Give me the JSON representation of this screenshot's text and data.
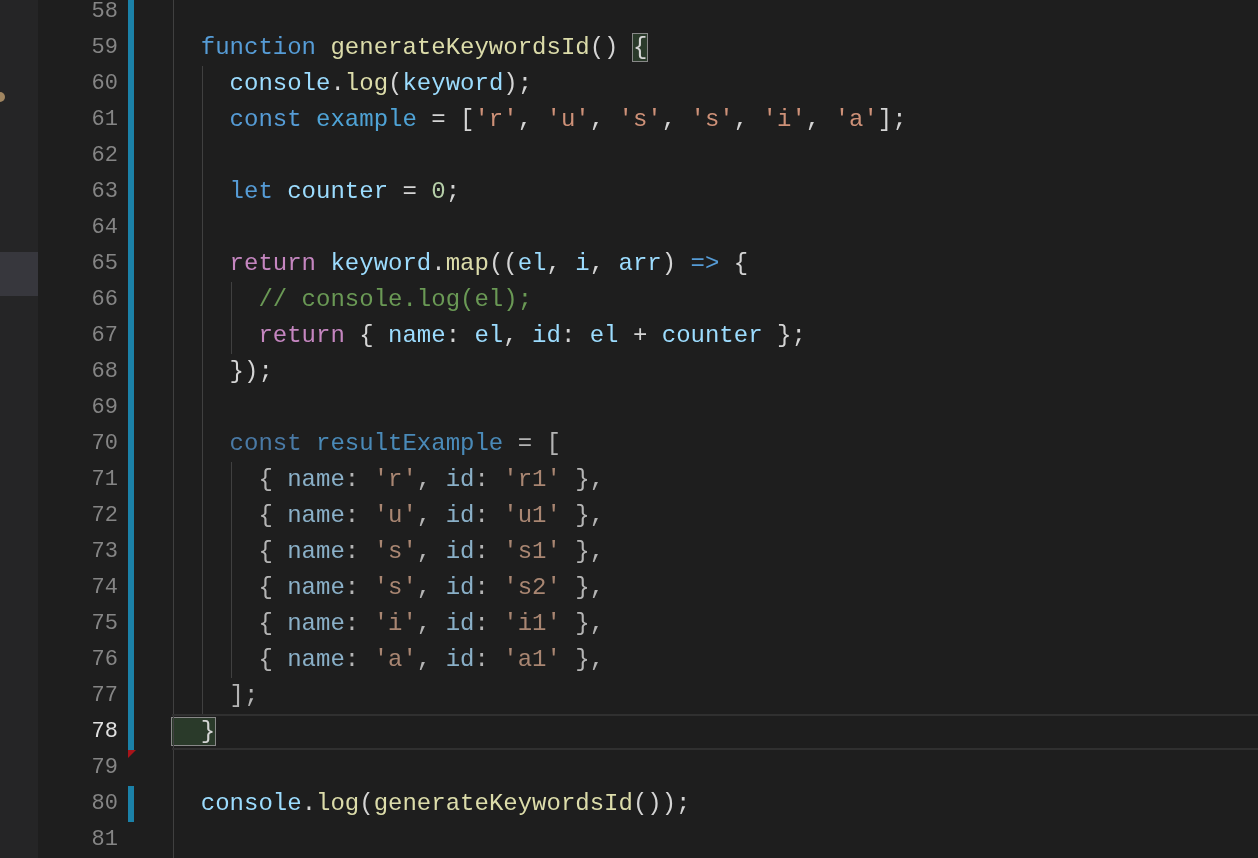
{
  "editor": {
    "lines": [
      {
        "number": "58",
        "current": false,
        "modified": true,
        "deleted": false
      },
      {
        "number": "59",
        "current": false,
        "modified": true,
        "deleted": false,
        "tokens": [
          {
            "text": "  function ",
            "kind": "keyword"
          },
          {
            "text": "generateKeywordsId",
            "kind": "function"
          },
          {
            "text": "() ",
            "kind": "plain"
          },
          {
            "text": "{",
            "kind": "bracket-match"
          }
        ]
      },
      {
        "number": "60",
        "current": false,
        "modified": true,
        "deleted": false,
        "tokens": [
          {
            "text": "    console",
            "kind": "variable"
          },
          {
            "text": ".",
            "kind": "plain"
          },
          {
            "text": "log",
            "kind": "function"
          },
          {
            "text": "(",
            "kind": "plain"
          },
          {
            "text": "keyword",
            "kind": "variable"
          },
          {
            "text": ");",
            "kind": "plain"
          }
        ]
      },
      {
        "number": "61",
        "current": false,
        "modified": true,
        "deleted": false,
        "tokens": [
          {
            "text": "    const ",
            "kind": "keyword"
          },
          {
            "text": "example",
            "kind": "constant"
          },
          {
            "text": " = [",
            "kind": "plain"
          },
          {
            "text": "'r'",
            "kind": "string"
          },
          {
            "text": ", ",
            "kind": "plain"
          },
          {
            "text": "'u'",
            "kind": "string"
          },
          {
            "text": ", ",
            "kind": "plain"
          },
          {
            "text": "'s'",
            "kind": "string"
          },
          {
            "text": ", ",
            "kind": "plain"
          },
          {
            "text": "'s'",
            "kind": "string"
          },
          {
            "text": ", ",
            "kind": "plain"
          },
          {
            "text": "'i'",
            "kind": "string"
          },
          {
            "text": ", ",
            "kind": "plain"
          },
          {
            "text": "'a'",
            "kind": "string"
          },
          {
            "text": "];",
            "kind": "plain"
          }
        ]
      },
      {
        "number": "62",
        "current": false,
        "modified": true,
        "deleted": false
      },
      {
        "number": "63",
        "current": false,
        "modified": true,
        "deleted": false,
        "tokens": [
          {
            "text": "    let ",
            "kind": "keyword"
          },
          {
            "text": "counter",
            "kind": "variable"
          },
          {
            "text": " = ",
            "kind": "plain"
          },
          {
            "text": "0",
            "kind": "number"
          },
          {
            "text": ";",
            "kind": "plain"
          }
        ]
      },
      {
        "number": "64",
        "current": false,
        "modified": true,
        "deleted": false
      },
      {
        "number": "65",
        "current": false,
        "modified": true,
        "deleted": false,
        "tokens": [
          {
            "text": "    return ",
            "kind": "control"
          },
          {
            "text": "keyword",
            "kind": "variable"
          },
          {
            "text": ".",
            "kind": "plain"
          },
          {
            "text": "map",
            "kind": "function"
          },
          {
            "text": "((",
            "kind": "plain"
          },
          {
            "text": "el",
            "kind": "variable"
          },
          {
            "text": ", ",
            "kind": "plain"
          },
          {
            "text": "i",
            "kind": "variable"
          },
          {
            "text": ", ",
            "kind": "plain"
          },
          {
            "text": "arr",
            "kind": "variable"
          },
          {
            "text": ") ",
            "kind": "plain"
          },
          {
            "text": "=>",
            "kind": "keyword"
          },
          {
            "text": " {",
            "kind": "plain"
          }
        ]
      },
      {
        "number": "66",
        "current": false,
        "modified": true,
        "deleted": false,
        "tokens": [
          {
            "text": "      // console.log(el);",
            "kind": "comment"
          }
        ]
      },
      {
        "number": "67",
        "current": false,
        "modified": true,
        "deleted": false,
        "tokens": [
          {
            "text": "      return",
            "kind": "control"
          },
          {
            "text": " { ",
            "kind": "plain"
          },
          {
            "text": "name",
            "kind": "variable"
          },
          {
            "text": ": ",
            "kind": "plain"
          },
          {
            "text": "el",
            "kind": "variable"
          },
          {
            "text": ", ",
            "kind": "plain"
          },
          {
            "text": "id",
            "kind": "variable"
          },
          {
            "text": ": ",
            "kind": "plain"
          },
          {
            "text": "el",
            "kind": "variable"
          },
          {
            "text": " + ",
            "kind": "plain"
          },
          {
            "text": "counter",
            "kind": "variable"
          },
          {
            "text": " };",
            "kind": "plain"
          }
        ]
      },
      {
        "number": "68",
        "current": false,
        "modified": true,
        "deleted": false,
        "tokens": [
          {
            "text": "    });",
            "kind": "plain"
          }
        ]
      },
      {
        "number": "69",
        "current": false,
        "modified": true,
        "deleted": false
      },
      {
        "number": "70",
        "current": false,
        "modified": true,
        "deleted": false,
        "tokens": [
          {
            "text": "    const ",
            "kind": "keyword-dim"
          },
          {
            "text": "resultExample",
            "kind": "constant-dim"
          },
          {
            "text": " = [",
            "kind": "plain-dim"
          }
        ]
      },
      {
        "number": "71",
        "current": false,
        "modified": true,
        "deleted": false,
        "tokens": [
          {
            "text": "      { ",
            "kind": "plain-dim"
          },
          {
            "text": "name",
            "kind": "variable-dim"
          },
          {
            "text": ": ",
            "kind": "plain-dim"
          },
          {
            "text": "'r'",
            "kind": "string-dim"
          },
          {
            "text": ", ",
            "kind": "plain-dim"
          },
          {
            "text": "id",
            "kind": "variable-dim"
          },
          {
            "text": ": ",
            "kind": "plain-dim"
          },
          {
            "text": "'r1'",
            "kind": "string-dim"
          },
          {
            "text": " },",
            "kind": "plain-dim"
          }
        ]
      },
      {
        "number": "72",
        "current": false,
        "modified": true,
        "deleted": false,
        "tokens": [
          {
            "text": "      { ",
            "kind": "plain-dim"
          },
          {
            "text": "name",
            "kind": "variable-dim"
          },
          {
            "text": ": ",
            "kind": "plain-dim"
          },
          {
            "text": "'u'",
            "kind": "string-dim"
          },
          {
            "text": ", ",
            "kind": "plain-dim"
          },
          {
            "text": "id",
            "kind": "variable-dim"
          },
          {
            "text": ": ",
            "kind": "plain-dim"
          },
          {
            "text": "'u1'",
            "kind": "string-dim"
          },
          {
            "text": " },",
            "kind": "plain-dim"
          }
        ]
      },
      {
        "number": "73",
        "current": false,
        "modified": true,
        "deleted": false,
        "tokens": [
          {
            "text": "      { ",
            "kind": "plain-dim"
          },
          {
            "text": "name",
            "kind": "variable-dim"
          },
          {
            "text": ": ",
            "kind": "plain-dim"
          },
          {
            "text": "'s'",
            "kind": "string-dim"
          },
          {
            "text": ", ",
            "kind": "plain-dim"
          },
          {
            "text": "id",
            "kind": "variable-dim"
          },
          {
            "text": ": ",
            "kind": "plain-dim"
          },
          {
            "text": "'s1'",
            "kind": "string-dim"
          },
          {
            "text": " },",
            "kind": "plain-dim"
          }
        ]
      },
      {
        "number": "74",
        "current": false,
        "modified": true,
        "deleted": false,
        "tokens": [
          {
            "text": "      { ",
            "kind": "plain-dim"
          },
          {
            "text": "name",
            "kind": "variable-dim"
          },
          {
            "text": ": ",
            "kind": "plain-dim"
          },
          {
            "text": "'s'",
            "kind": "string-dim"
          },
          {
            "text": ", ",
            "kind": "plain-dim"
          },
          {
            "text": "id",
            "kind": "variable-dim"
          },
          {
            "text": ": ",
            "kind": "plain-dim"
          },
          {
            "text": "'s2'",
            "kind": "string-dim"
          },
          {
            "text": " },",
            "kind": "plain-dim"
          }
        ]
      },
      {
        "number": "75",
        "current": false,
        "modified": true,
        "deleted": false,
        "tokens": [
          {
            "text": "      { ",
            "kind": "plain-dim"
          },
          {
            "text": "name",
            "kind": "variable-dim"
          },
          {
            "text": ": ",
            "kind": "plain-dim"
          },
          {
            "text": "'i'",
            "kind": "string-dim"
          },
          {
            "text": ", ",
            "kind": "plain-dim"
          },
          {
            "text": "id",
            "kind": "variable-dim"
          },
          {
            "text": ": ",
            "kind": "plain-dim"
          },
          {
            "text": "'i1'",
            "kind": "string-dim"
          },
          {
            "text": " },",
            "kind": "plain-dim"
          }
        ]
      },
      {
        "number": "76",
        "current": false,
        "modified": true,
        "deleted": false,
        "tokens": [
          {
            "text": "      { ",
            "kind": "plain-dim"
          },
          {
            "text": "name",
            "kind": "variable-dim"
          },
          {
            "text": ": ",
            "kind": "plain-dim"
          },
          {
            "text": "'a'",
            "kind": "string-dim"
          },
          {
            "text": ", ",
            "kind": "plain-dim"
          },
          {
            "text": "id",
            "kind": "variable-dim"
          },
          {
            "text": ": ",
            "kind": "plain-dim"
          },
          {
            "text": "'a1'",
            "kind": "string-dim"
          },
          {
            "text": " },",
            "kind": "plain-dim"
          }
        ]
      },
      {
        "number": "77",
        "current": false,
        "modified": true,
        "deleted": false,
        "tokens": [
          {
            "text": "    ];",
            "kind": "plain-dim"
          }
        ]
      },
      {
        "number": "78",
        "current": true,
        "modified": true,
        "deleted": false,
        "tokens": [
          {
            "text": "  }",
            "kind": "bracket-match"
          }
        ]
      },
      {
        "number": "79",
        "current": false,
        "modified": false,
        "deleted": true
      },
      {
        "number": "80",
        "current": false,
        "modified": true,
        "deleted": false,
        "tokens": [
          {
            "text": "  console",
            "kind": "variable"
          },
          {
            "text": ".",
            "kind": "plain"
          },
          {
            "text": "log",
            "kind": "function"
          },
          {
            "text": "(",
            "kind": "plain"
          },
          {
            "text": "generateKeywordsId",
            "kind": "function"
          },
          {
            "text": "());",
            "kind": "plain"
          }
        ]
      },
      {
        "number": "81",
        "current": false,
        "modified": false,
        "deleted": false
      }
    ]
  }
}
